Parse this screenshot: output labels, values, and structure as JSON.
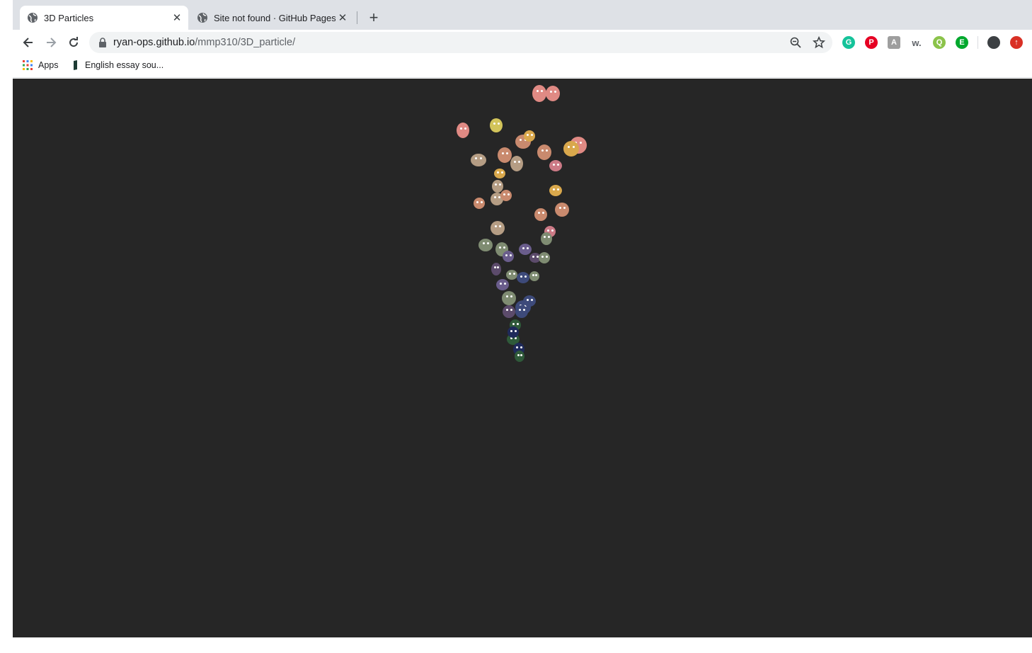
{
  "browser": {
    "tabs": [
      {
        "title": "3D Particles",
        "active": true
      },
      {
        "title": "Site not found · GitHub Pages",
        "active": false
      }
    ],
    "address": {
      "host": "ryan-ops.github.io",
      "path": "/mmp310/3D_particle/"
    },
    "bookmarks": [
      {
        "label": "Apps",
        "icon": "apps-grid-icon"
      },
      {
        "label": "English essay sou...",
        "icon": "bookmark-favicon"
      }
    ],
    "extensions": [
      {
        "name": "grammarly-icon",
        "glyph": "G",
        "color": "#15c39a"
      },
      {
        "name": "pinterest-icon",
        "glyph": "P",
        "color": "#e60023"
      },
      {
        "name": "translate-icon",
        "glyph": "A",
        "color": "#9e9e9e"
      },
      {
        "name": "wordtune-icon",
        "glyph": "w.",
        "color": "#5f6368"
      },
      {
        "name": "quip-icon",
        "glyph": "Q",
        "color": "#8bc34a"
      },
      {
        "name": "evernote-icon",
        "glyph": "E",
        "color": "#00a82d"
      },
      {
        "name": "profile-avatar-icon",
        "glyph": "",
        "color": "#3c4043"
      },
      {
        "name": "update-icon",
        "glyph": "↑",
        "color": "#d93025"
      }
    ]
  },
  "scene": {
    "background": "#262626",
    "particle_colors": [
      "#e08a84",
      "#d2c45a",
      "#c98a6e",
      "#b59d84",
      "#cc7a86",
      "#d9a84c",
      "#7f8c72",
      "#6a5d8c",
      "#5c4b6b",
      "#3d4a7a",
      "#2f5a3a",
      "#1f2a5a"
    ]
  }
}
